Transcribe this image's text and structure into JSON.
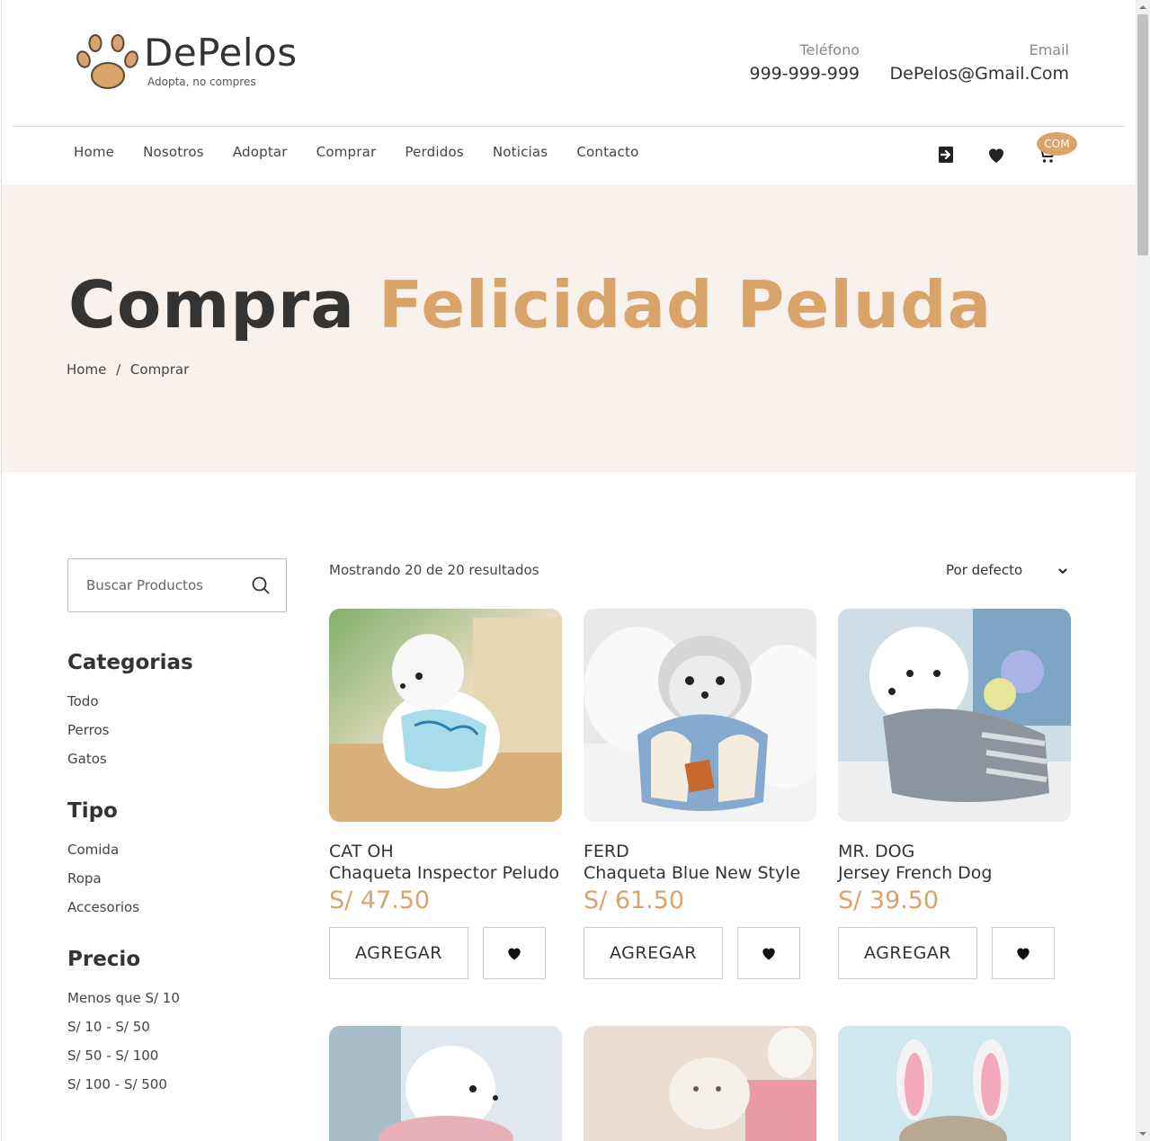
{
  "brand": {
    "name": "DePelos",
    "tagline": "Adopta, no compres",
    "accent_color": "#d9a46a"
  },
  "contact": {
    "phone_label": "Teléfono",
    "phone_value": "999-999-999",
    "email_label": "Email",
    "email_value": "DePelos@Gmail.Com"
  },
  "nav": {
    "items": [
      "Home",
      "Nosotros",
      "Adoptar",
      "Comprar",
      "Perdidos",
      "Noticias",
      "Contacto"
    ],
    "cart_badge": "COM",
    "icons": [
      "login-icon",
      "heart-icon",
      "cart-icon"
    ]
  },
  "hero": {
    "title_main": "Compra",
    "title_accent": "Felicidad Peluda",
    "breadcrumb": [
      "Home",
      "/",
      "Comprar"
    ]
  },
  "sidebar": {
    "search_placeholder": "Buscar Productos",
    "categories_title": "Categorias",
    "categories": [
      "Todo",
      "Perros",
      "Gatos"
    ],
    "type_title": "Tipo",
    "types": [
      "Comida",
      "Ropa",
      "Accesorios"
    ],
    "price_title": "Precio",
    "prices": [
      "Menos que S/ 10",
      "S/ 10 - S/ 50",
      "S/ 50 - S/ 100",
      "S/ 100 - S/ 500"
    ]
  },
  "toolbar": {
    "results": "Mostrando 20 de 20 resultados",
    "sort": "Por defecto"
  },
  "products": [
    {
      "brand": "CAT OH",
      "name": "Chaqueta Inspector Peludo",
      "price": "S/ 47.50",
      "add_label": "AGREGAR"
    },
    {
      "brand": "FERD",
      "name": "Chaqueta Blue New Style",
      "price": "S/ 61.50",
      "add_label": "AGREGAR"
    },
    {
      "brand": "MR. DOG",
      "name": "Jersey French Dog",
      "price": "S/ 39.50",
      "add_label": "AGREGAR"
    }
  ]
}
